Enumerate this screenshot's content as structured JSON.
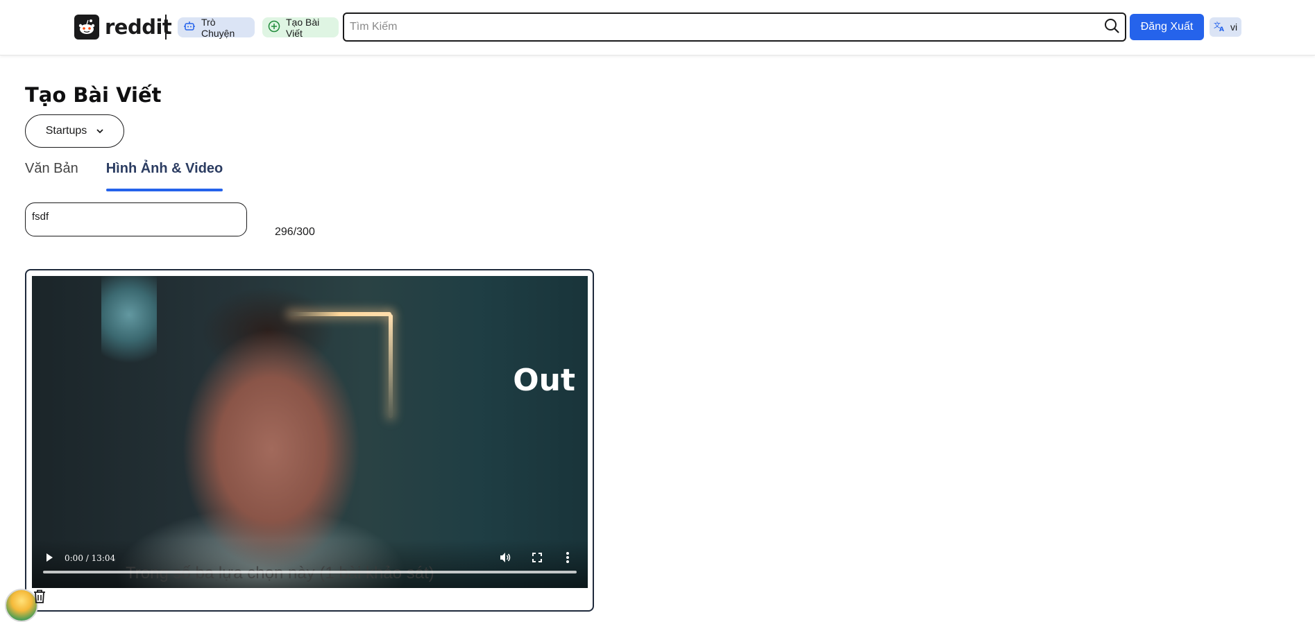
{
  "header": {
    "logo_text": "reddit",
    "chat_label": "Trò Chuyện",
    "create_label": "Tạo Bài Viết",
    "search_placeholder": "Tìm Kiếm",
    "logout_label": "Đăng Xuất",
    "language_label": "vi"
  },
  "main": {
    "title": "Tạo Bài Viết",
    "community_selected": "Startups",
    "tabs": [
      {
        "label": "Văn Bản",
        "active": false
      },
      {
        "label": "Hình Ảnh & Video",
        "active": true
      }
    ],
    "post_title_value": "fsdf",
    "char_count": "296/300",
    "video": {
      "overlay_text": "Out",
      "subtitle_text": "Trong số ba lựa chọn này (1 bài khảo sát)",
      "time": "0:00 / 13:04",
      "progress": 0
    }
  },
  "colors": {
    "accent": "#2563eb",
    "chat_chip": "#dbe4f5",
    "create_chip": "#dff5e3",
    "border_dark": "#1e293b"
  },
  "icons": {
    "chat": "bot-icon",
    "create": "plus-circle-icon",
    "search": "search-icon",
    "language": "translate-icon",
    "trash": "trash-icon"
  }
}
